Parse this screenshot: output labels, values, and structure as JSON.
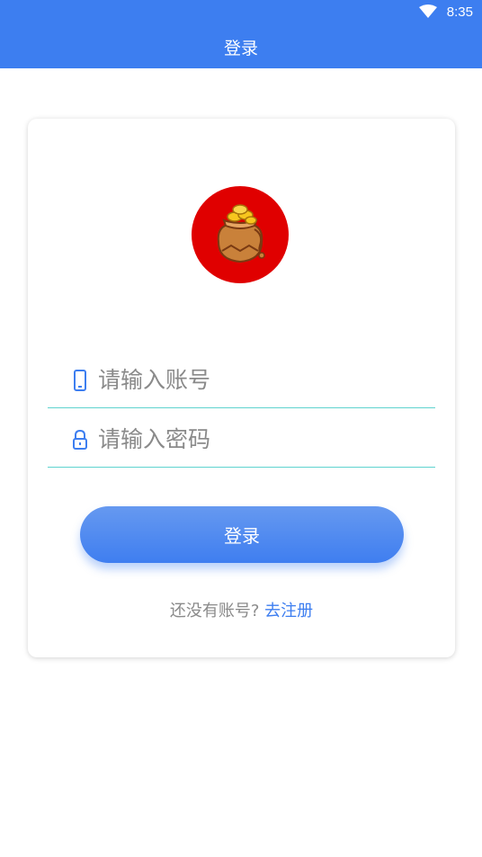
{
  "status_bar": {
    "time": "8:35"
  },
  "app_bar": {
    "title": "登录"
  },
  "login": {
    "account_placeholder": "请输入账号",
    "password_placeholder": "请输入密码",
    "submit_label": "登录",
    "register_prompt": "还没有账号?",
    "register_link": "去注册"
  },
  "icons": {
    "wifi": "wifi-icon",
    "logo": "coin-bag-icon",
    "account": "phone-icon",
    "password": "lock-icon"
  },
  "colors": {
    "primary": "#3d7ef0",
    "logo_background": "#e00000",
    "field_underline": "#5fd3cf"
  }
}
